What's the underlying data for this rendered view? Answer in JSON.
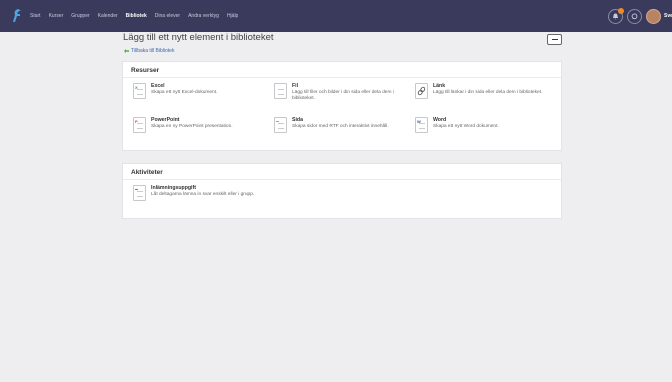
{
  "colors": {
    "topbar": "#3a3a5c",
    "accent_orange": "#f08a24",
    "excel_green": "#2e9b47",
    "powerpoint_red": "#d24726",
    "word_blue": "#2b5797",
    "link": "#3a6aa8"
  },
  "nav": {
    "items": [
      "Start",
      "Kurser",
      "Grupper",
      "Kalender",
      "Bibliotek",
      "Dina elever",
      "Andra verktyg",
      "Hjälp"
    ],
    "active": "Bibliotek"
  },
  "user": {
    "name": "Sven"
  },
  "header": {
    "title": "Lägg till ett nytt element i biblioteket",
    "back_link": "Tillbaka till Bibliotek"
  },
  "resources": {
    "heading": "Resurser",
    "items": [
      {
        "title": "Excel",
        "desc": "Skapa ett nytt Excel-dokument.",
        "icon": "excel-file-icon"
      },
      {
        "title": "Fil",
        "desc": "Lägg till filer och bilder i din sida eller dela dem i biblioteket.",
        "icon": "file-icon"
      },
      {
        "title": "Länk",
        "desc": "Lägg till länkar i din sida eller dela dem i biblioteket.",
        "icon": "link-icon"
      },
      {
        "title": "PowerPoint",
        "desc": "Skapa en ny PowerPoint presentation.",
        "icon": "powerpoint-file-icon"
      },
      {
        "title": "Sida",
        "desc": "Skapa sidor med RTF och interaktivt innehåll.",
        "icon": "page-icon"
      },
      {
        "title": "Word",
        "desc": "Skapa ett nytt Word dokument.",
        "icon": "word-file-icon"
      }
    ]
  },
  "activities": {
    "heading": "Aktiviteter",
    "items": [
      {
        "title": "Inlämningsuppgift",
        "desc": "Låt deltagarna lämna in svar enskilt eller i grupp.",
        "icon": "assignment-icon"
      }
    ]
  }
}
